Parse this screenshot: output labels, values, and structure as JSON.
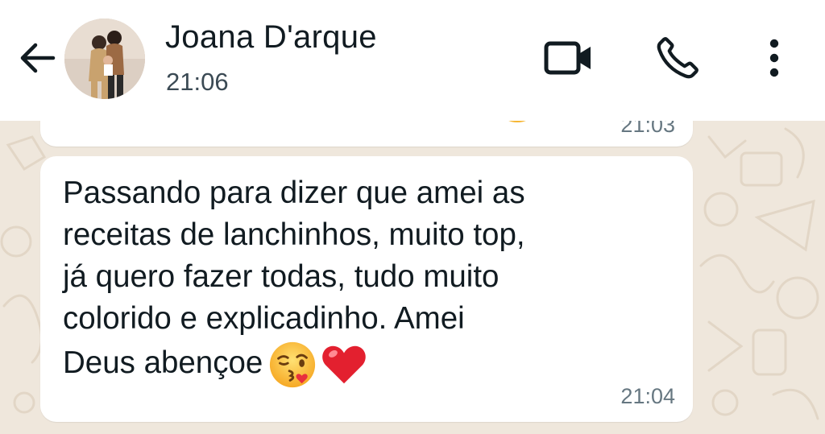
{
  "header": {
    "back_icon": "arrow-left-icon",
    "contact_name": "Joana D'arque",
    "status": "21:06",
    "video_icon": "video-camera-icon",
    "call_icon": "phone-icon",
    "menu_icon": "more-vertical-icon"
  },
  "messages": [
    {
      "time": "21:03",
      "emoji": "partial-emoji",
      "partial": true
    },
    {
      "lines": [
        "Passando para dizer que amei as",
        "receitas de lanchinhos, muito top,",
        "já quero fazer todas, tudo muito",
        "colorido e explicadinho. Amei",
        "Deus abençoe"
      ],
      "emojis": [
        "kissing-face-icon",
        "red-heart-icon"
      ],
      "time": "21:04"
    }
  ],
  "colors": {
    "header_bg": "#ffffff",
    "chat_bg": "#efe7dc",
    "bubble_bg": "#ffffff",
    "text": "#111b21",
    "time_text": "#667781"
  }
}
